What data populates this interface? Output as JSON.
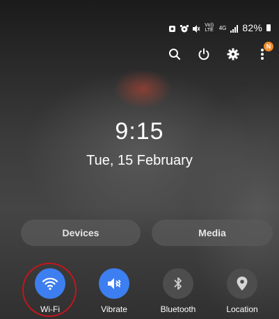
{
  "status_bar": {
    "icons": [
      "alarm-clock-icon",
      "alarm-icon",
      "mute-icon",
      "volte-icon",
      "4g-icon",
      "signal-icon"
    ],
    "volte_label": "Vo)) LTE",
    "network_label": "4G",
    "battery_percent": "82%"
  },
  "header_actions": {
    "notification_badge": "N"
  },
  "lock": {
    "time": "9:15",
    "date": "Tue, 15 February"
  },
  "shortcuts": {
    "devices": "Devices",
    "media": "Media"
  },
  "quick_tiles": [
    {
      "label": "Wi-Fi",
      "active": true,
      "icon": "wifi-icon"
    },
    {
      "label": "Vibrate",
      "active": true,
      "icon": "vibrate-icon"
    },
    {
      "label": "Bluetooth",
      "active": false,
      "icon": "bluetooth-icon"
    },
    {
      "label": "Location",
      "active": false,
      "icon": "location-icon"
    }
  ],
  "colors": {
    "active_tile": "#3d7ef0",
    "inactive_tile": "#4d4d4d",
    "highlight": "#c4161c",
    "badge": "#f28a2a"
  }
}
